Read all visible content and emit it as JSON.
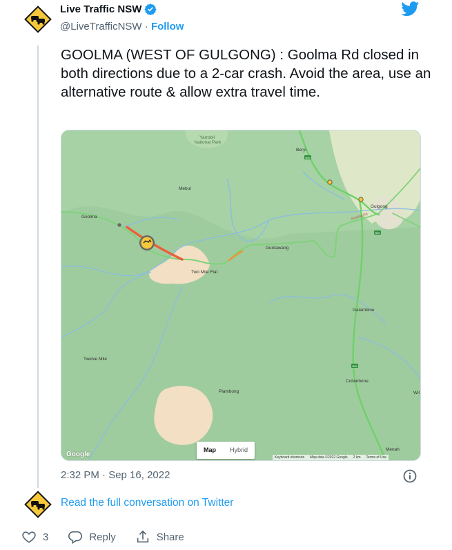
{
  "author": {
    "display_name": "Live Traffic NSW",
    "handle": "@LiveTrafficNSW",
    "separator": "·",
    "follow_label": "Follow",
    "avatar_icon": "traffic-jam-sign-icon",
    "verified_icon": "verified-badge-icon"
  },
  "tweet": {
    "text": "GOOLMA (WEST OF GULGONG) : Goolma Rd closed in both directions due to a 2-car crash. Avoid the area, use an alternative route & allow extra travel time.",
    "timestamp": "2:32 PM · Sep 16, 2022"
  },
  "map": {
    "places": {
      "yarrobil": "Yarrobil\nNational Park",
      "beryl": "Beryl",
      "mebul": "Mebul",
      "gulgong": "Gulgong",
      "goolma": "Goolma",
      "guntawang": "Guntawang",
      "two_mile_flat": "Two Mile Flat",
      "galambine": "Galambine",
      "twelve_mile": "Twelve Mile",
      "cullenbone": "Cullenbone",
      "piambong": "Piambong",
      "menah": "Menah",
      "wi": "Wil",
      "goolma_rd": "Goolma Rd"
    },
    "shields": {
      "b55": "B55"
    },
    "toggle": {
      "map": "Map",
      "hybrid": "Hybrid"
    },
    "google": "Google",
    "footer": {
      "shortcuts": "Keyboard shortcuts",
      "data": "Map data ©2022 Google",
      "scale": "2 km",
      "terms": "Terms of Use"
    },
    "colors": {
      "land": "#a6d2a5",
      "water": "#8bbde0",
      "urban": "#f2dfc4",
      "road": "#6fd16a",
      "closure": "#e9603a"
    }
  },
  "read_more_label": "Read the full conversation on Twitter",
  "actions": {
    "like_count": "3",
    "reply_label": "Reply",
    "share_label": "Share"
  }
}
